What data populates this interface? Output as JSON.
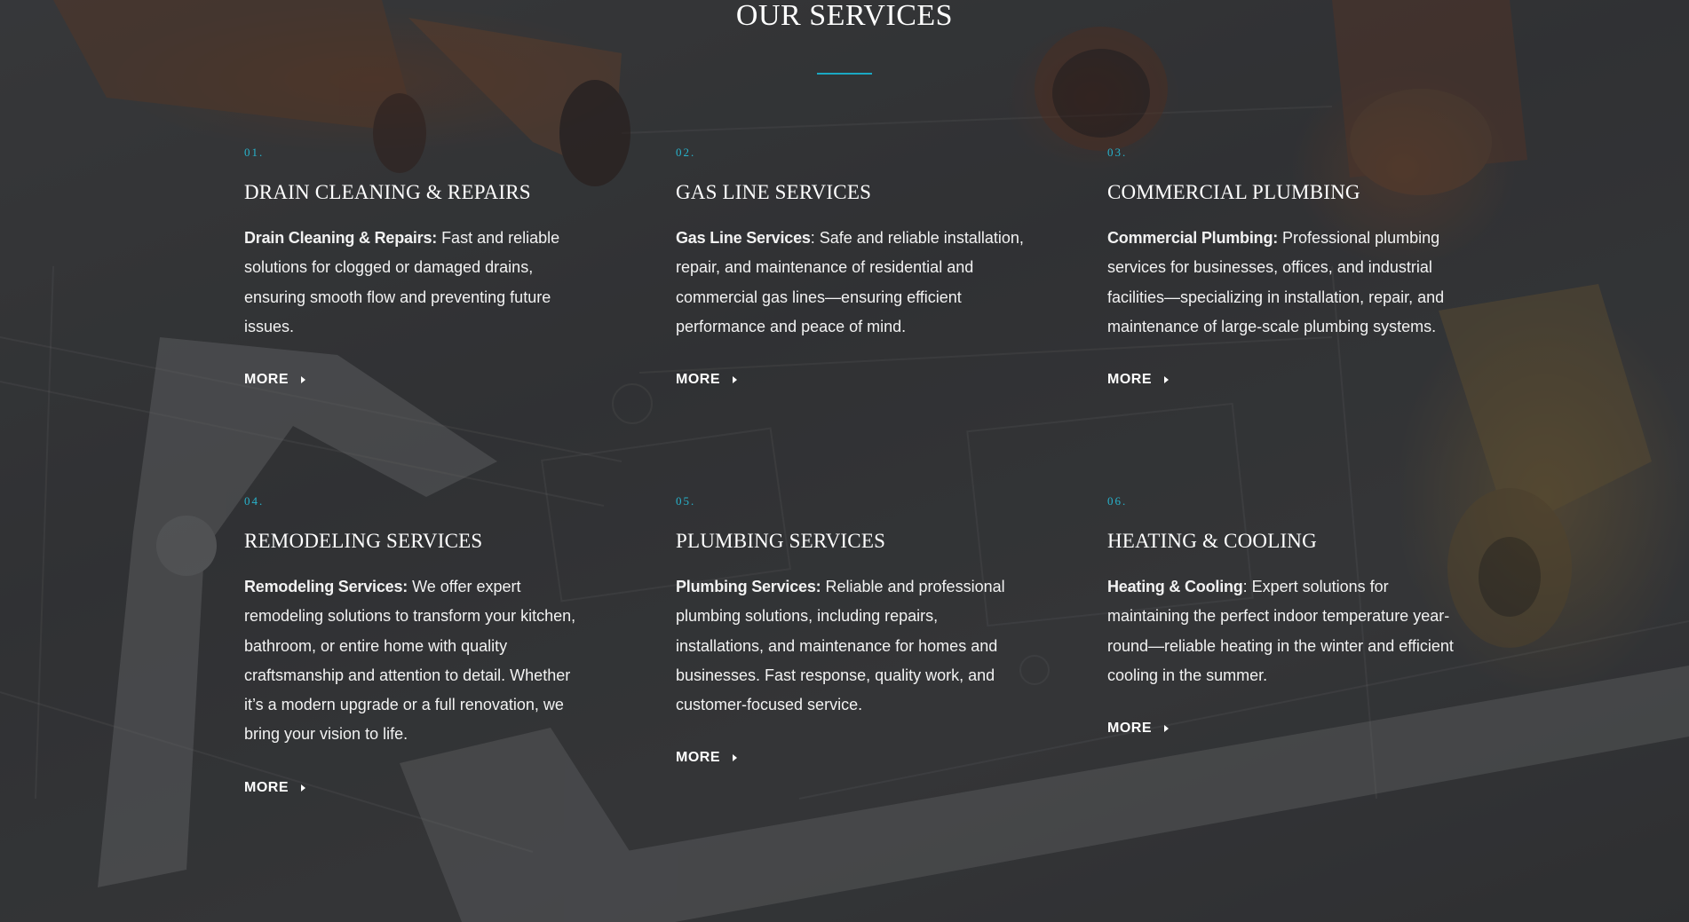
{
  "section": {
    "title": "OUR SERVICES",
    "accent_color": "#1ba8c3"
  },
  "services": [
    {
      "number": "01.",
      "title": "DRAIN CLEANING & REPAIRS",
      "lead": "Drain Cleaning & Repairs:",
      "text": " Fast and reliable solutions for clogged or damaged drains, ensuring smooth flow and preventing future issues.",
      "more": "MORE"
    },
    {
      "number": "02.",
      "title": "GAS LINE SERVICES",
      "lead": "Gas Line Services",
      "text": ": Safe and reliable installation, repair, and maintenance of residential and commercial gas lines—ensuring efficient performance and peace of mind.",
      "more": "MORE"
    },
    {
      "number": "03.",
      "title": "COMMERCIAL PLUMBING",
      "lead": "Commercial Plumbing:",
      "text": " Professional plumbing services for businesses, offices, and industrial facilities—specializing in installation, repair, and maintenance of large-scale plumbing systems.",
      "more": "MORE"
    },
    {
      "number": "04.",
      "title": "REMODELING SERVICES",
      "lead": "Remodeling Services:",
      "text": " We offer expert remodeling solutions to transform your kitchen, bathroom, or entire home with quality craftsmanship and attention to detail. Whether it’s a modern upgrade or a full renovation, we bring your vision to life.",
      "more": "MORE"
    },
    {
      "number": "05.",
      "title": "PLUMBING SERVICES",
      "lead": "Plumbing Services:",
      "text": " Reliable and professional plumbing solutions, including repairs, installations, and maintenance for homes and businesses. Fast response, quality work, and customer-focused service.",
      "more": "MORE"
    },
    {
      "number": "06.",
      "title": "HEATING & COOLING",
      "lead": "Heating & Cooling",
      "text": ": Expert solutions for maintaining the perfect indoor temperature year-round—reliable heating in the winter and efficient cooling in the summer.",
      "more": "MORE"
    }
  ]
}
